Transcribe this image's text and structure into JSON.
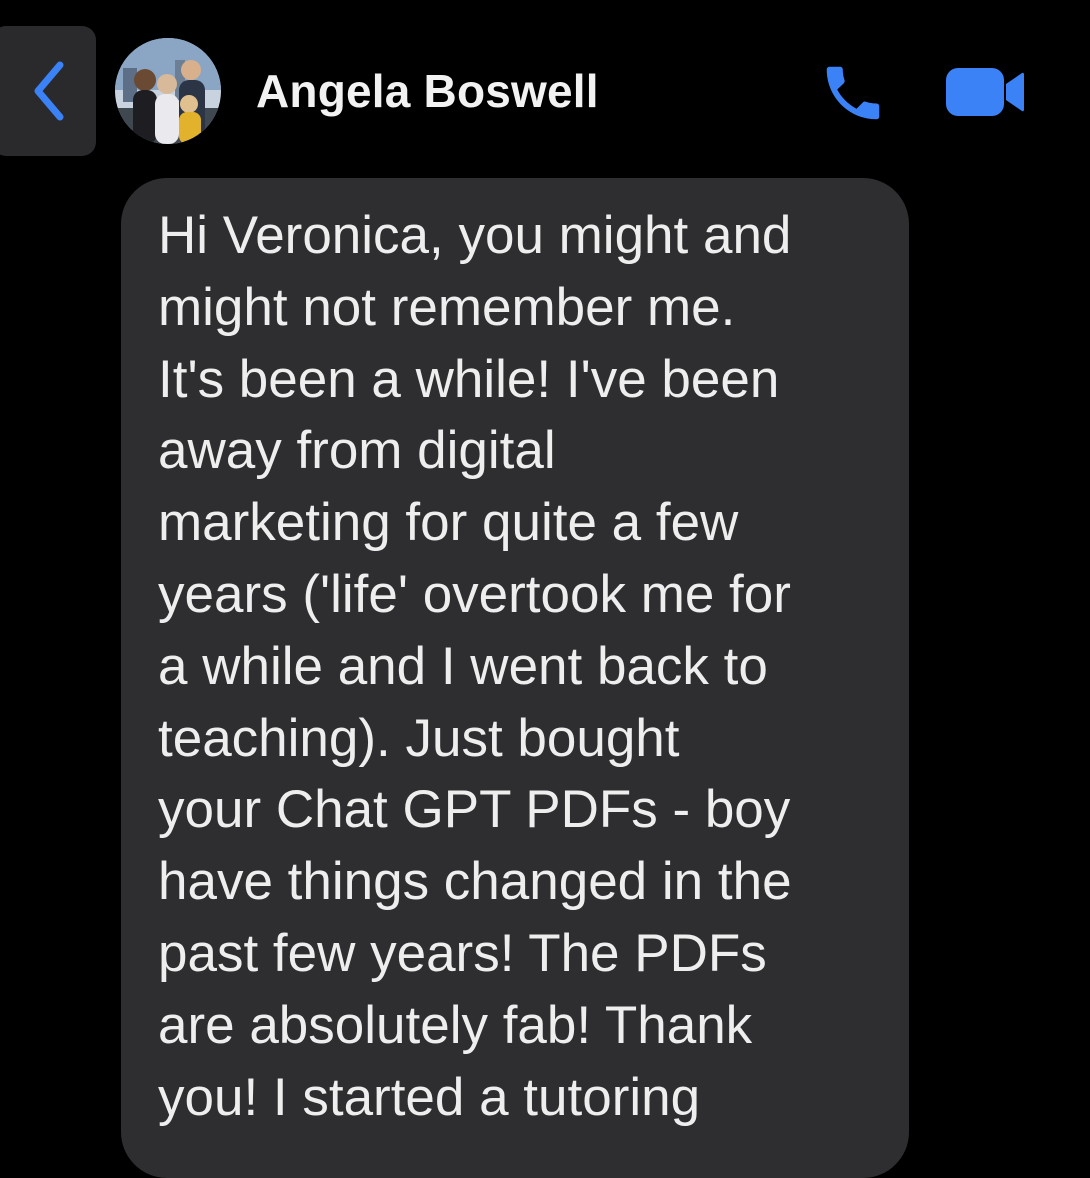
{
  "header": {
    "contact_name": "Angela Boswell",
    "back_icon": "chevron-left-icon",
    "call_icon": "phone-icon",
    "video_icon": "video-camera-icon",
    "accent_color": "#3b82f6"
  },
  "message": {
    "lines": [
      "Hi Veronica, you might and",
      "might not remember me.",
      "It's been a while! I've been",
      "away from digital",
      "marketing for quite a few",
      "years ('life' overtook me for",
      "a while and I went back to",
      "teaching). Just bought",
      "your Chat GPT PDFs - boy",
      "have things changed in the",
      "past few years! The PDFs",
      "are absolutely fab! Thank",
      "you! I started a tutoring"
    ]
  }
}
